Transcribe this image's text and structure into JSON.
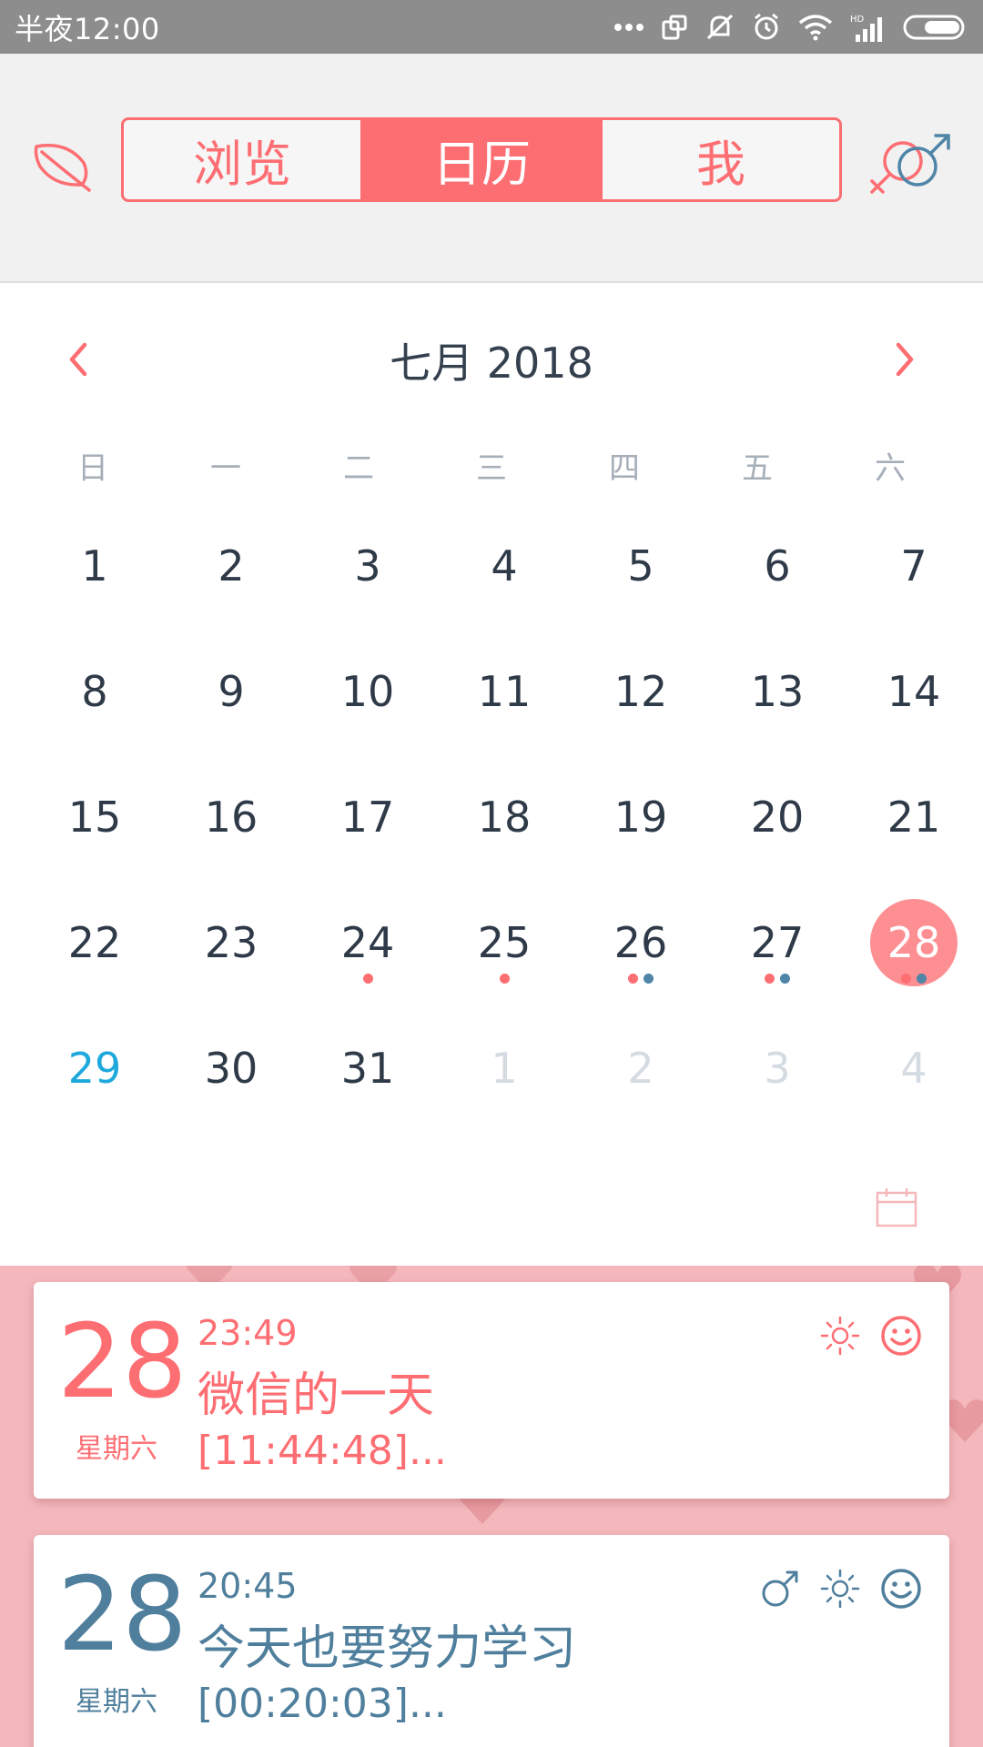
{
  "status_bar": {
    "time": "半夜12:00"
  },
  "header": {
    "tabs": [
      {
        "label": "浏览",
        "active": false
      },
      {
        "label": "日历",
        "active": true
      },
      {
        "label": "我",
        "active": false
      }
    ]
  },
  "calendar": {
    "month_title": "七月 2018",
    "weekdays": [
      "日",
      "一",
      "二",
      "三",
      "四",
      "五",
      "六"
    ],
    "weeks": [
      [
        {
          "n": "1"
        },
        {
          "n": "2"
        },
        {
          "n": "3"
        },
        {
          "n": "4"
        },
        {
          "n": "5"
        },
        {
          "n": "6"
        },
        {
          "n": "7"
        }
      ],
      [
        {
          "n": "8"
        },
        {
          "n": "9"
        },
        {
          "n": "10"
        },
        {
          "n": "11"
        },
        {
          "n": "12"
        },
        {
          "n": "13"
        },
        {
          "n": "14"
        }
      ],
      [
        {
          "n": "15"
        },
        {
          "n": "16"
        },
        {
          "n": "17"
        },
        {
          "n": "18"
        },
        {
          "n": "19"
        },
        {
          "n": "20"
        },
        {
          "n": "21"
        }
      ],
      [
        {
          "n": "22"
        },
        {
          "n": "23"
        },
        {
          "n": "24",
          "dots": [
            "red"
          ]
        },
        {
          "n": "25",
          "dots": [
            "red"
          ]
        },
        {
          "n": "26",
          "dots": [
            "red",
            "blue"
          ]
        },
        {
          "n": "27",
          "dots": [
            "red",
            "blue"
          ]
        },
        {
          "n": "28",
          "dots": [
            "red",
            "blue"
          ],
          "selected": true
        }
      ],
      [
        {
          "n": "29",
          "today": true
        },
        {
          "n": "30"
        },
        {
          "n": "31"
        },
        {
          "n": "1",
          "other": true
        },
        {
          "n": "2",
          "other": true
        },
        {
          "n": "3",
          "other": true
        },
        {
          "n": "4",
          "other": true
        }
      ]
    ]
  },
  "entries": [
    {
      "day": "28",
      "weekday": "星期六",
      "time": "23:49",
      "title": "微信的一天",
      "snippet": "[11:44:48]...",
      "icons": [
        "sun-icon",
        "smile-icon"
      ]
    },
    {
      "day": "28",
      "weekday": "星期六",
      "time": "20:45",
      "title": "今天也要努力学习",
      "snippet": "[00:20:03]...",
      "icons": [
        "male-icon",
        "sun-icon",
        "smile-icon"
      ]
    }
  ],
  "colors": {
    "accent": "#fd6e73",
    "blue_accent": "#4f7f9c",
    "today_blue": "#1ea9dd",
    "selected_circle": "#fd8f93",
    "diary_bg": "#f4b8bc"
  }
}
